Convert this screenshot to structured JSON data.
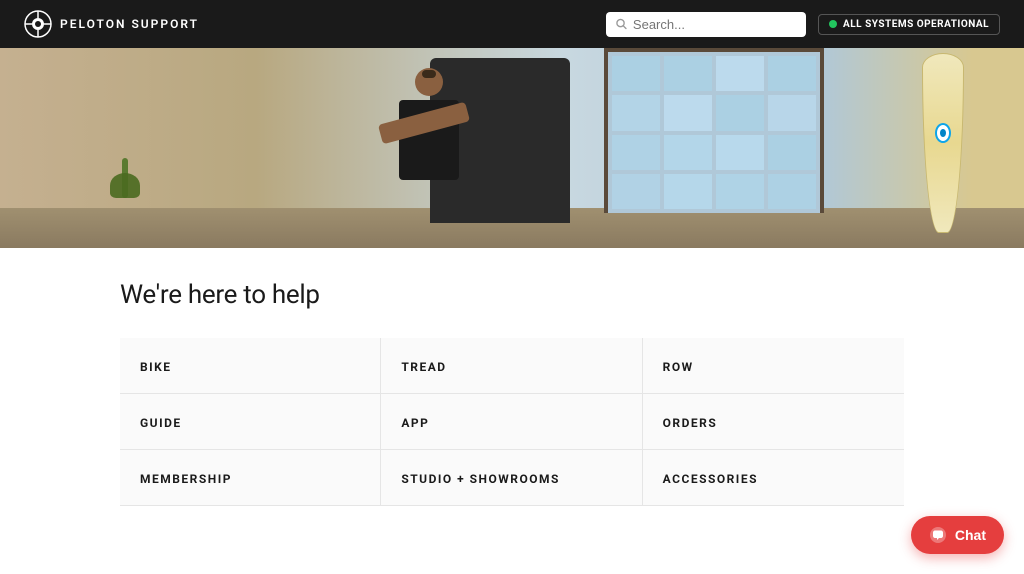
{
  "header": {
    "logo_text": "PELOTON SUPPORT",
    "search_placeholder": "Search...",
    "systems_status": "ALL SYSTEMS OPERATIONAL"
  },
  "main": {
    "help_title": "We're here to help",
    "categories": [
      {
        "id": "bike",
        "label": "BIKE"
      },
      {
        "id": "tread",
        "label": "TREAD"
      },
      {
        "id": "row",
        "label": "ROW"
      },
      {
        "id": "guide",
        "label": "GUIDE"
      },
      {
        "id": "app",
        "label": "APP"
      },
      {
        "id": "orders",
        "label": "ORDERS"
      },
      {
        "id": "membership",
        "label": "MEMBERSHIP"
      },
      {
        "id": "studio-showrooms",
        "label": "STUDIO + SHOWROOMS"
      },
      {
        "id": "accessories",
        "label": "ACCESSORIES"
      }
    ]
  },
  "chat": {
    "label": "Chat"
  }
}
